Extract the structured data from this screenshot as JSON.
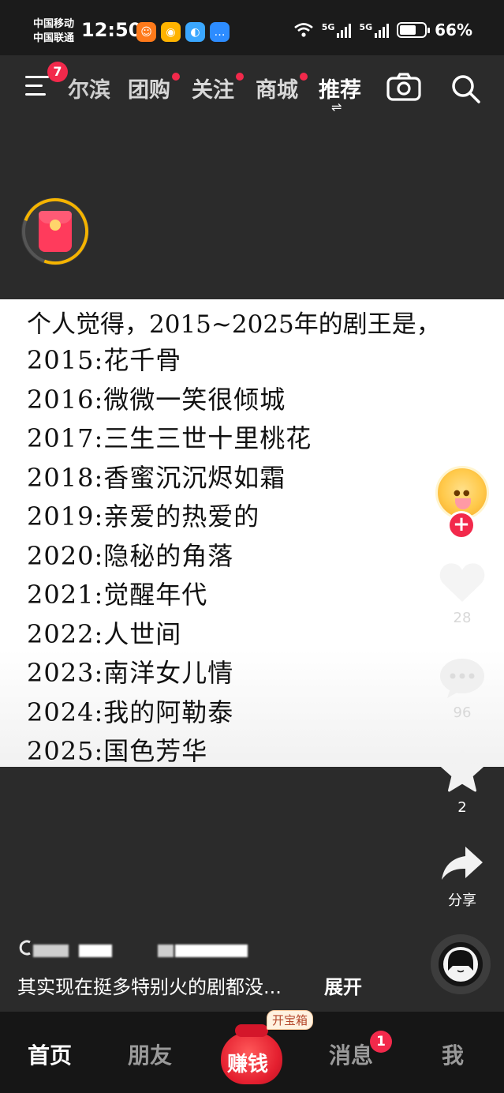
{
  "status_bar": {
    "carrier_1": "中国移动",
    "carrier_2": "中国联通",
    "time": "12:50",
    "battery": "66%",
    "battery_level": 0.66,
    "network_1": "5G",
    "network_2": "5G",
    "app_icons": [
      "taobao-icon",
      "weibo-icon",
      "qq-browser-icon",
      "message-icon"
    ]
  },
  "top_nav": {
    "menu_badge": "7",
    "tabs": [
      {
        "label": "尔滨",
        "dot": false
      },
      {
        "label": "团购",
        "dot": true
      },
      {
        "label": "关注",
        "dot": true
      },
      {
        "label": "商城",
        "dot": true
      },
      {
        "label": "推荐",
        "dot": false,
        "active": true
      }
    ],
    "swap_glyph": "⇌"
  },
  "post": {
    "headline": "个人觉得，2015~2025年的剧王是，",
    "dramas": [
      "2015:花千骨",
      "2016:微微一笑很倾城",
      "2017:三生三世十里桃花",
      "2018:香蜜沉沉烬如霜",
      "2019:亲爱的热爱的",
      "2020:隐秘的角落",
      "2021:觉醒年代",
      "2022:人世间",
      "2023:南洋女儿情",
      "2024:我的阿勒泰",
      "2025:国色芳华"
    ]
  },
  "actions": {
    "like_count": "28",
    "comment_count": "96",
    "favorite_count": "2",
    "share_label": "分享",
    "follow_glyph": "+"
  },
  "caption": {
    "text": "其实现在挺多特别火的剧都没...",
    "expand": "展开"
  },
  "bottom_nav": {
    "home": "首页",
    "friends": "朋友",
    "earn": "赚钱",
    "treasure_tag": "开宝箱",
    "messages": "消息",
    "messages_badge": "1",
    "me": "我"
  },
  "colors": {
    "accent_red": "#f2294b",
    "background": "#2b2b2b",
    "card": "#ffffff"
  }
}
